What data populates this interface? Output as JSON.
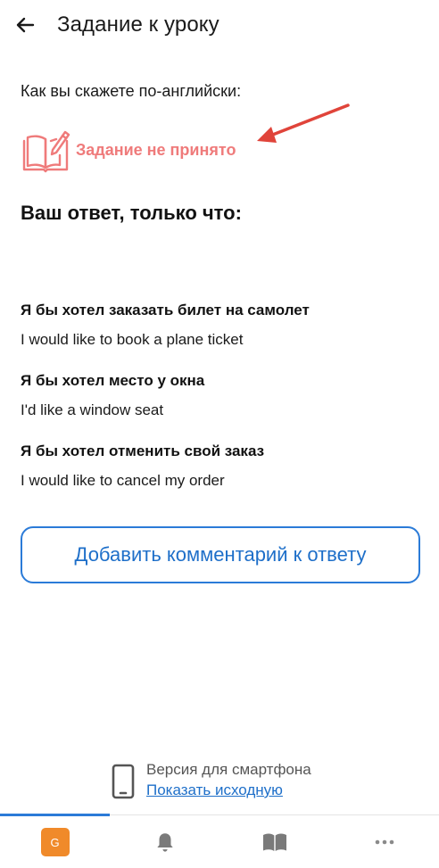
{
  "header": {
    "title": "Задание к уроку",
    "back_icon": "arrow-left-icon"
  },
  "task": {
    "prompt": "Как вы скажете по-английски:",
    "status_text": "Задание не принято",
    "status_icon": "book-pencil-icon",
    "status_color": "#ef7b7b"
  },
  "answer": {
    "heading": "Ваш ответ, только что:",
    "items": [
      {
        "ru": "Я бы хотел заказать билет на самолет",
        "en": "I would like to book a plane ticket"
      },
      {
        "ru": "Я бы хотел место у окна",
        "en": "I'd like a window seat"
      },
      {
        "ru": "Я бы хотел отменить свой заказ",
        "en": "I would like to cancel my order"
      }
    ]
  },
  "comment_button": {
    "label": "Добавить комментарий к ответу"
  },
  "version": {
    "label": "Версия для смартфона",
    "link": "Показать исходную",
    "icon": "smartphone-icon"
  },
  "bottom_nav": {
    "avatar_letter": "G",
    "items": [
      "avatar",
      "bell-icon",
      "book-icon",
      "more-icon"
    ]
  },
  "colors": {
    "accent": "#2b7bd8",
    "link": "#1e6fc9",
    "error": "#ef7b7b",
    "annotation": "#e0443a",
    "avatar": "#f08a2a"
  }
}
